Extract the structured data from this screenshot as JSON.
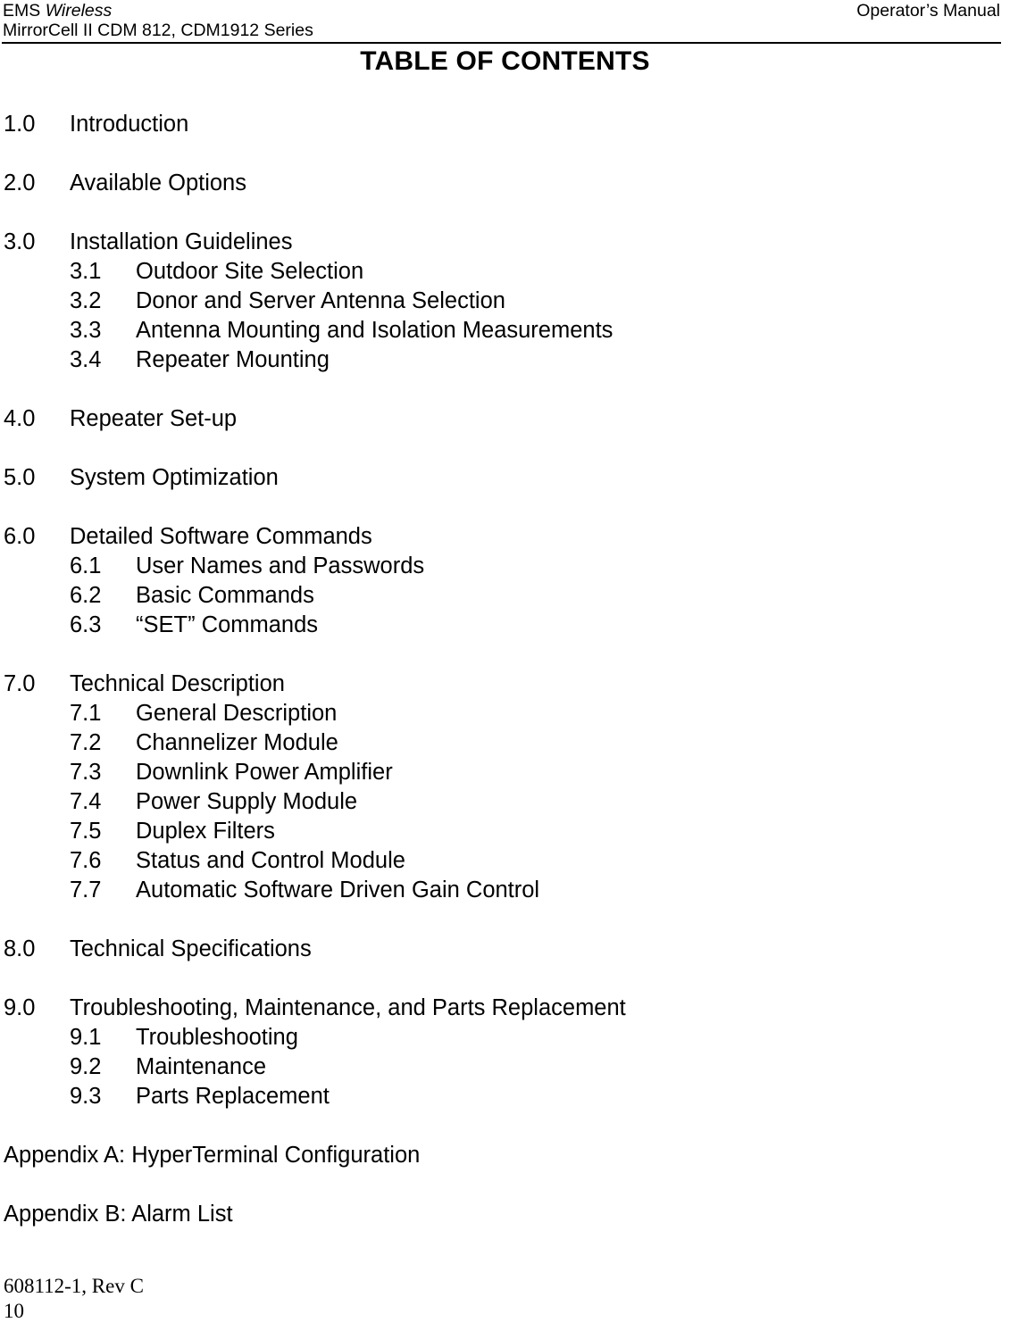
{
  "header": {
    "left_company": "EMS ",
    "left_company_italic": "Wireless",
    "left_product": "MirrorCell II CDM 812, CDM1912 Series",
    "right_label": "Operator’s Manual"
  },
  "title": "TABLE OF CONTENTS",
  "toc": {
    "entries": [
      {
        "level": 1,
        "number": "1.0",
        "label": "Introduction"
      },
      {
        "level": 1,
        "number": "2.0",
        "label": "Available Options"
      },
      {
        "level": 1,
        "number": "3.0",
        "label": "Installation Guidelines"
      },
      {
        "level": 2,
        "number": "3.1",
        "label": "Outdoor Site Selection"
      },
      {
        "level": 2,
        "number": "3.2",
        "label": "Donor and Server Antenna Selection"
      },
      {
        "level": 2,
        "number": "3.3",
        "label": "Antenna Mounting and Isolation Measurements"
      },
      {
        "level": 2,
        "number": "3.4",
        "label": "Repeater Mounting"
      },
      {
        "level": 1,
        "number": "4.0",
        "label": "Repeater Set-up"
      },
      {
        "level": 1,
        "number": "5.0",
        "label": "System Optimization"
      },
      {
        "level": 1,
        "number": "6.0",
        "label": "Detailed Software Commands"
      },
      {
        "level": 2,
        "number": "6.1",
        "label": "User Names and Passwords"
      },
      {
        "level": 2,
        "number": "6.2",
        "label": "Basic Commands"
      },
      {
        "level": 2,
        "number": "6.3",
        "label": "“SET” Commands"
      },
      {
        "level": 1,
        "number": "7.0",
        "label": "Technical Description"
      },
      {
        "level": 2,
        "number": "7.1",
        "label": "General Description"
      },
      {
        "level": 2,
        "number": "7.2",
        "label": "Channelizer Module"
      },
      {
        "level": 2,
        "number": "7.3",
        "label": "Downlink Power Amplifier"
      },
      {
        "level": 2,
        "number": "7.4",
        "label": "Power Supply Module"
      },
      {
        "level": 2,
        "number": "7.5",
        "label": "Duplex Filters"
      },
      {
        "level": 2,
        "number": "7.6",
        "label": "Status and Control Module"
      },
      {
        "level": 2,
        "number": "7.7",
        "label": "Automatic Software Driven Gain Control"
      },
      {
        "level": 1,
        "number": "8.0",
        "label": "Technical Specifications"
      },
      {
        "level": 1,
        "number": "9.0",
        "label": "Troubleshooting, Maintenance, and Parts Replacement"
      },
      {
        "level": 2,
        "number": "9.1",
        "label": "Troubleshooting"
      },
      {
        "level": 2,
        "number": "9.2",
        "label": "Maintenance"
      },
      {
        "level": 2,
        "number": "9.3",
        "label": "Parts Replacement"
      }
    ],
    "appendices": [
      {
        "label": "Appendix A:  HyperTerminal Configuration"
      },
      {
        "label": "Appendix B: Alarm List"
      }
    ]
  },
  "footer": {
    "document_number": "608112-1, Rev C",
    "page_number": "10"
  }
}
